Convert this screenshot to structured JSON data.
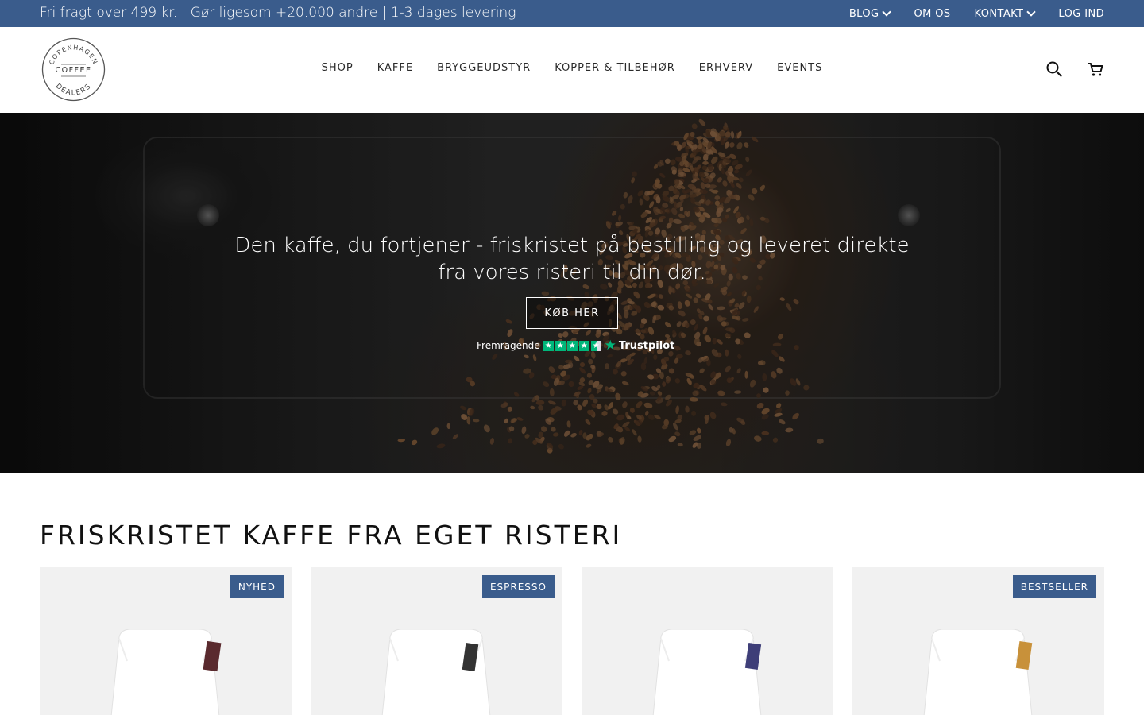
{
  "announcement": {
    "text": "Fri fragt over 499 kr. | Gør ligesom +20.000 andre | 1-3 dages levering",
    "links": [
      {
        "label": "BLOG",
        "has_dropdown": true
      },
      {
        "label": "OM OS",
        "has_dropdown": false
      },
      {
        "label": "KONTAKT",
        "has_dropdown": true
      },
      {
        "label": "LOG IND",
        "has_dropdown": false
      }
    ]
  },
  "brand": {
    "logo_text_top": "COPENHAGEN",
    "logo_text_mid": "COFFEE",
    "logo_text_bottom": "DEALERS"
  },
  "nav": {
    "items": [
      "SHOP",
      "KAFFE",
      "BRYGGEUDSTYR",
      "KOPPER & TILBEHØR",
      "ERHVERV",
      "EVENTS"
    ]
  },
  "header_icons": [
    "search-icon",
    "cart-icon"
  ],
  "hero": {
    "title_line1": "Den kaffe, du fortjener - friskristet på bestilling og leveret direkte",
    "title_line2": "fra vores risteri til din dør.",
    "button_label": "KØB HER",
    "trustpilot": {
      "rating_label": "Fremragende",
      "stars": 4.5,
      "brand": "Trustpilot"
    }
  },
  "section": {
    "title": "FRISKRISTET KAFFE FRA EGET RISTERI",
    "products": [
      {
        "badge": "NYHED",
        "label_color": "#5a2a2e"
      },
      {
        "badge": "ESPRESSO",
        "label_color": "#333333"
      },
      {
        "badge": "",
        "label_color": "#3e3e78"
      },
      {
        "badge": "BESTSELLER",
        "label_color": "#c8913a"
      }
    ]
  },
  "colors": {
    "brand_blue": "#3a5c8c",
    "trustpilot_green": "#00b67a",
    "card_bg": "#f1f1f1"
  }
}
